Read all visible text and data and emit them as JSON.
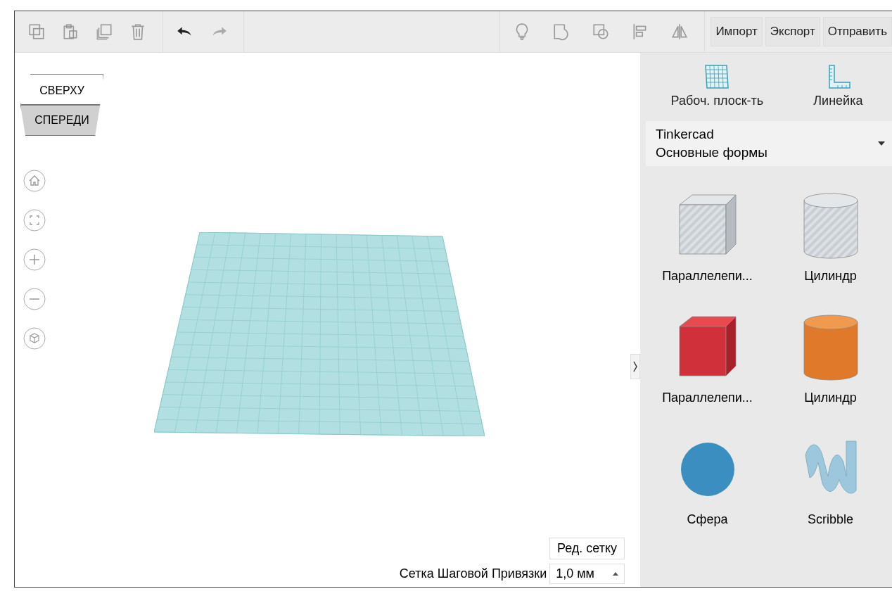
{
  "toolbar": {
    "buttons": [
      "Импорт",
      "Экспорт",
      "Отправить"
    ]
  },
  "view_cube": {
    "top": "СВЕРХУ",
    "front": "СПЕРЕДИ"
  },
  "panel": {
    "tools": [
      {
        "kind": "workplane",
        "label": "Рабоч. плоск-ть"
      },
      {
        "kind": "ruler",
        "label": "Линейка"
      }
    ],
    "category": {
      "line_1": "Tinkercad",
      "line_2": "Основные формы"
    },
    "shapes": [
      {
        "kind": "striped-box",
        "label": "Параллелепи..."
      },
      {
        "kind": "striped-cylinder",
        "label": "Цилиндр"
      },
      {
        "kind": "box",
        "label": "Параллелепи..."
      },
      {
        "kind": "cylinder",
        "label": "Цилиндр"
      },
      {
        "kind": "sphere",
        "label": "Сфера"
      },
      {
        "kind": "scribble",
        "label": "Scribble"
      }
    ]
  },
  "grid_edit": {
    "label": "Ред. сетку"
  },
  "snap_grid": {
    "label": "Сетка Шаговой Привязки",
    "value": "1,0 мм"
  }
}
